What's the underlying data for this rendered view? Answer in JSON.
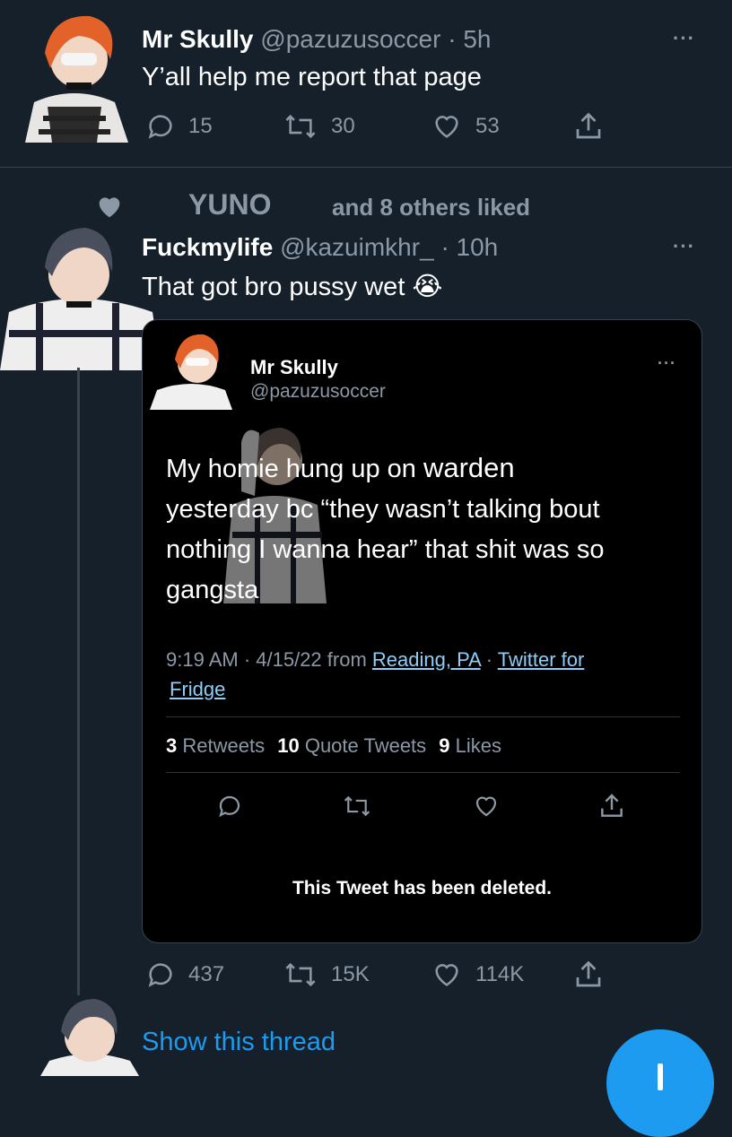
{
  "colors": {
    "background": "#15202b",
    "accent": "#1d9bf0",
    "muted": "#8b98a5",
    "link": "#8ecdf8"
  },
  "tweet1": {
    "name": "Mr Skully",
    "handle": "@pazuzusoccer",
    "time": "· 5h",
    "text": "Y’all help me report that page",
    "replies": "15",
    "retweets": "30",
    "likes": "53",
    "more_icon": "more-icon"
  },
  "social_context": {
    "liker": "YUNO",
    "rest": "and 8 others liked",
    "icon": "heart-icon"
  },
  "tweet2": {
    "name": "Fuckmylife",
    "handle": "@kazuimkhr_",
    "time": "· 10h",
    "text": "That got bro pussy wet",
    "emoji": "😭",
    "replies": "437",
    "retweets": "15K",
    "likes": "114K"
  },
  "quoted": {
    "name": "Mr Skully",
    "handle": "@pazuzusoccer",
    "text_line1": "My homie hung up on ",
    "text_highlight": "warden",
    "text_line2a": "yesterday bc “",
    "text_they": "they",
    "text_line2b": "wasn’t talking bout",
    "text_line3": "nothing I wanna hear” that shit was so",
    "text_line4": "gangsta",
    "meta_time": "9:19 AM · 4/15/22 from ",
    "meta_location": "Reading, PA",
    "meta_sep": " · ",
    "meta_source_a": "Twitter for",
    "meta_source_b": "Fridge ",
    "retweets_count": "3",
    "retweets_label": "Retweets",
    "quotes_count": "10",
    "quotes_label": "Quote Tweets",
    "likes_count": "9",
    "likes_label": "Likes",
    "deleted_notice": "This Tweet has been deleted."
  },
  "thread": {
    "show_label": "Show this thread"
  }
}
